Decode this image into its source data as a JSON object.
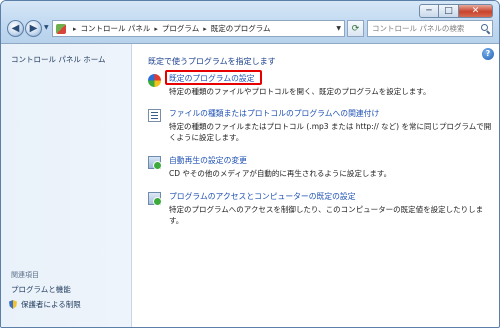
{
  "titlebar": {
    "minimize_glyph": "─",
    "maximize_glyph": "□",
    "close_glyph": "✕"
  },
  "nav": {
    "back_glyph": "◀",
    "forward_glyph": "▶"
  },
  "address": {
    "breadcrumbs": [
      "コントロール パネル",
      "プログラム",
      "既定のプログラム"
    ],
    "separator": "▸"
  },
  "search": {
    "placeholder": "コントロール パネルの検索"
  },
  "sidebar": {
    "home": "コントロール パネル ホーム",
    "related_heading": "関連項目",
    "related_links": [
      "プログラムと機能",
      "保護者による制限"
    ]
  },
  "main": {
    "title": "既定で使うプログラムを指定します",
    "items": [
      {
        "icon": "default-programs-icon",
        "link": "既定のプログラムの設定",
        "description": "特定の種類のファイルやプロトコルを開く、既定のプログラムを設定します。"
      },
      {
        "icon": "file-association-icon",
        "link": "ファイルの種類またはプロトコルのプログラムへの関連付け",
        "description": "特定の種類のファイルまたはプロトコル (.mp3 または http:// など) を常に同じプログラムで開くように設定します。"
      },
      {
        "icon": "autoplay-icon",
        "link": "自動再生の設定の変更",
        "description": "CD やその他のメディアが自動的に再生されるように設定します。"
      },
      {
        "icon": "program-access-icon",
        "link": "プログラムのアクセスとコンピューターの既定の設定",
        "description": "特定のプログラムへのアクセスを制御したり、このコンピューターの既定値を設定したりします。"
      }
    ]
  },
  "colors": {
    "link": "#1c4fb3",
    "highlight_border": "#e60000",
    "sidebar_bg": "#e9f1fa"
  }
}
